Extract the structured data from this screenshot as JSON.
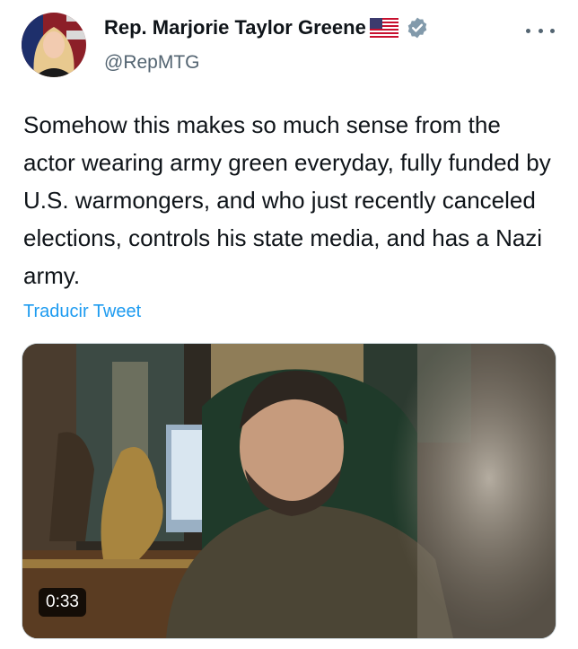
{
  "tweet": {
    "author": {
      "display_name": "Rep. Marjorie Taylor Greene",
      "handle": "@RepMTG",
      "flag_icon": "us-flag-emoji",
      "verified_icon": "verified-badge-icon",
      "verified_color": "#829aab"
    },
    "more_icon": "more-options-icon",
    "text": "Somehow this makes so much sense from the actor wearing army green everyday, fully funded by U.S. warmongers, and who just recently canceled elections, controls his state media, and has a Nazi army.",
    "translate_label": "Traducir Tweet",
    "media": {
      "type": "video",
      "duration": "0:33"
    },
    "colors": {
      "text": "#0f1419",
      "secondary": "#536471",
      "link": "#1d9bf0"
    }
  }
}
